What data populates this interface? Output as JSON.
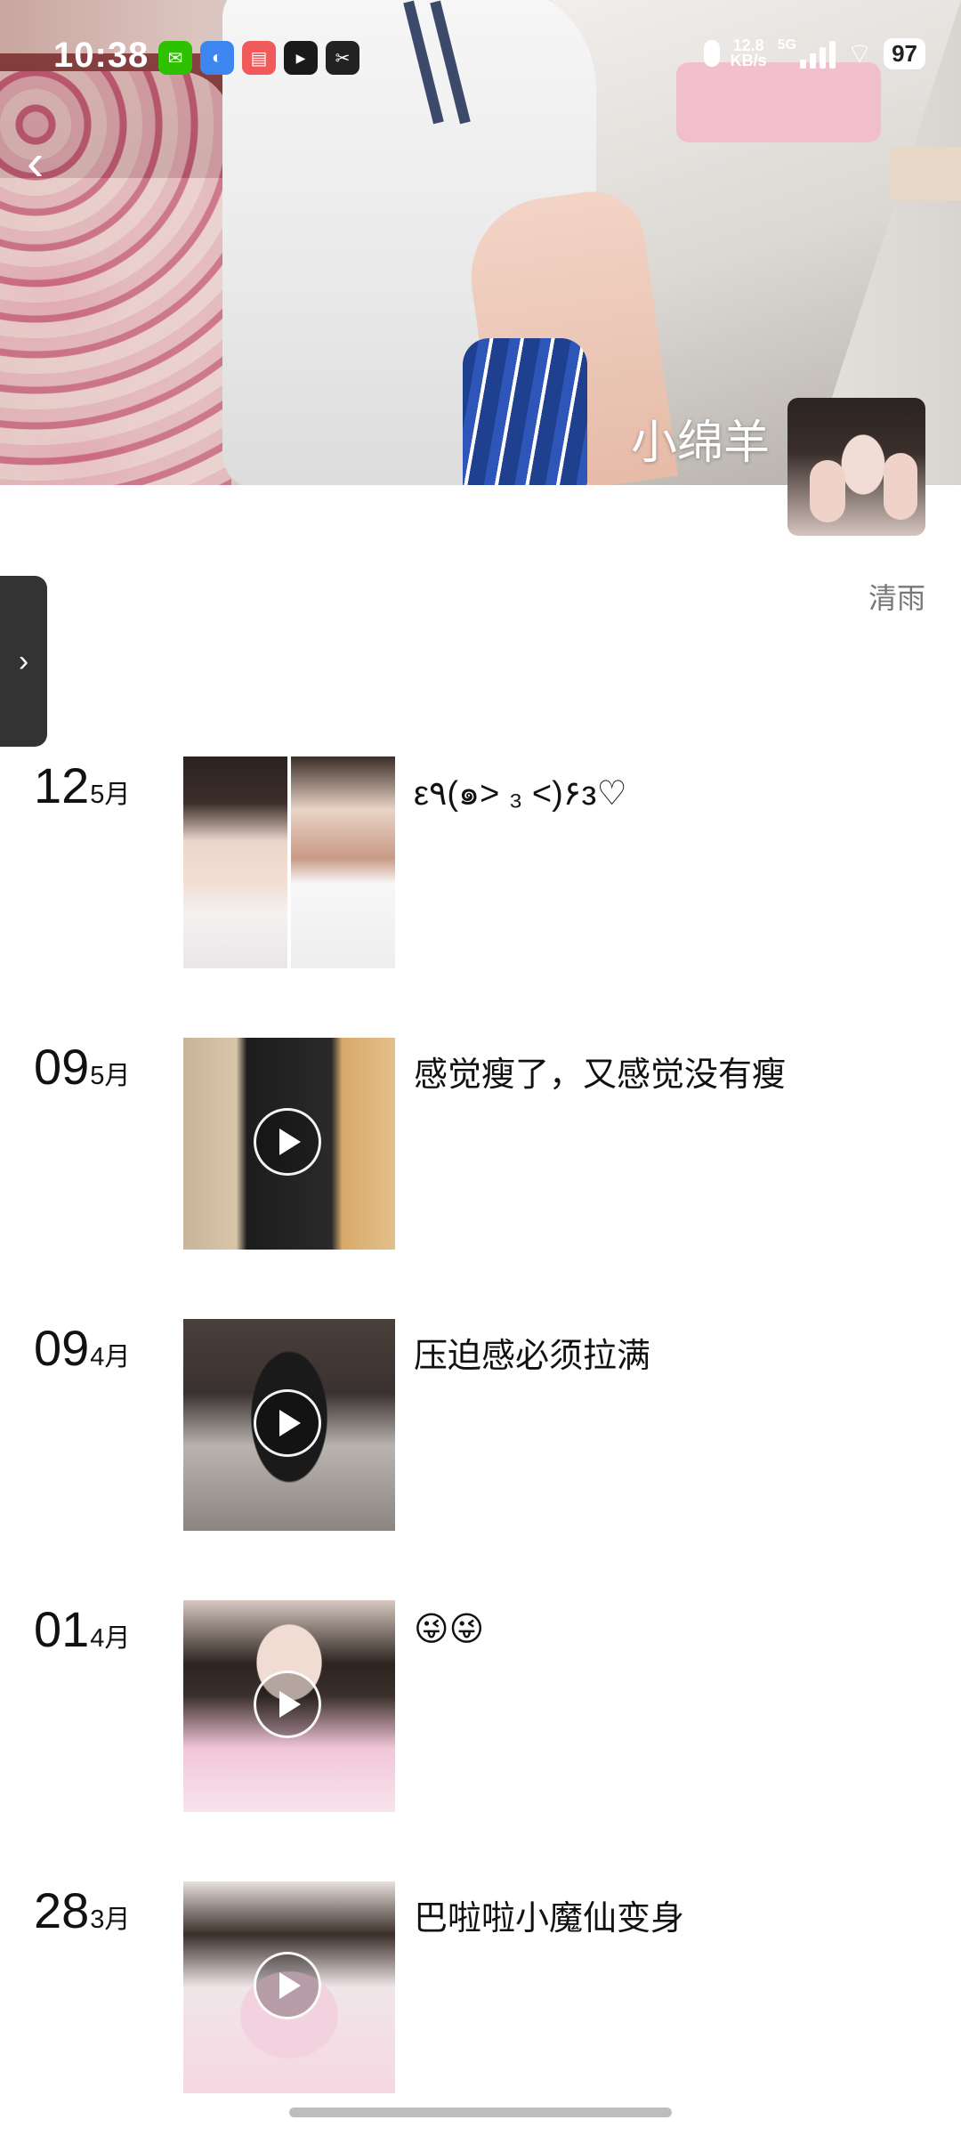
{
  "status_bar": {
    "time": "10:38",
    "notification_icons": [
      "wechat-icon",
      "app-icon-blue",
      "app-icon-red",
      "video-app-icon",
      "capcut-icon"
    ],
    "net_speed_value": "12.8",
    "net_speed_unit": "KB/s",
    "network_type": "5G",
    "battery": "97"
  },
  "profile": {
    "name": "小绵羊",
    "signature": "清雨"
  },
  "posts": [
    {
      "day": "12",
      "month": "5月",
      "caption": "ε٩(๑> ₃ <)۶з♡",
      "is_video": false
    },
    {
      "day": "09",
      "month": "5月",
      "caption": "感觉瘦了，又感觉没有瘦",
      "is_video": true
    },
    {
      "day": "09",
      "month": "4月",
      "caption": "压迫感必须拉满",
      "is_video": true
    },
    {
      "day": "01",
      "month": "4月",
      "caption": "😜😜",
      "is_video": true
    },
    {
      "day": "28",
      "month": "3月",
      "caption": "巴啦啦小魔仙变身",
      "is_video": true
    }
  ],
  "colors": {
    "background": "#ffffff",
    "signature_text": "#777777",
    "side_tab": "#333333"
  }
}
